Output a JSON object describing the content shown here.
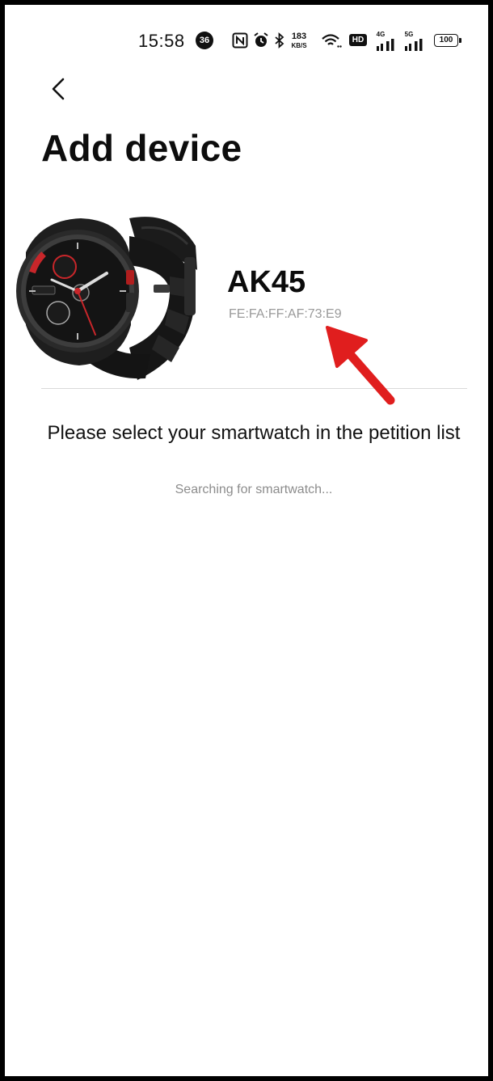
{
  "status_bar": {
    "time": "15:58",
    "notification_count": "36",
    "network_speed_value": "183",
    "network_speed_unit": "KB/S",
    "hd_label": "HD",
    "sim1_label": "4G",
    "sim2_label": "5G",
    "battery": "100",
    "icons": [
      "nfc-icon",
      "alarm-icon",
      "bluetooth-icon",
      "wifi-icon",
      "signal-icon"
    ]
  },
  "header": {
    "back_icon": "chevron-left-icon",
    "title": "Add device"
  },
  "device": {
    "name": "AK45",
    "mac": "FE:FA:FF:AF:73:E9"
  },
  "instruction": "Please select your smartwatch in the petition list",
  "status_text": "Searching for smartwatch...",
  "colors": {
    "annotation_arrow": "#e01e1e",
    "secondary_text": "#9a9a9a",
    "divider": "#d9d9d9"
  }
}
